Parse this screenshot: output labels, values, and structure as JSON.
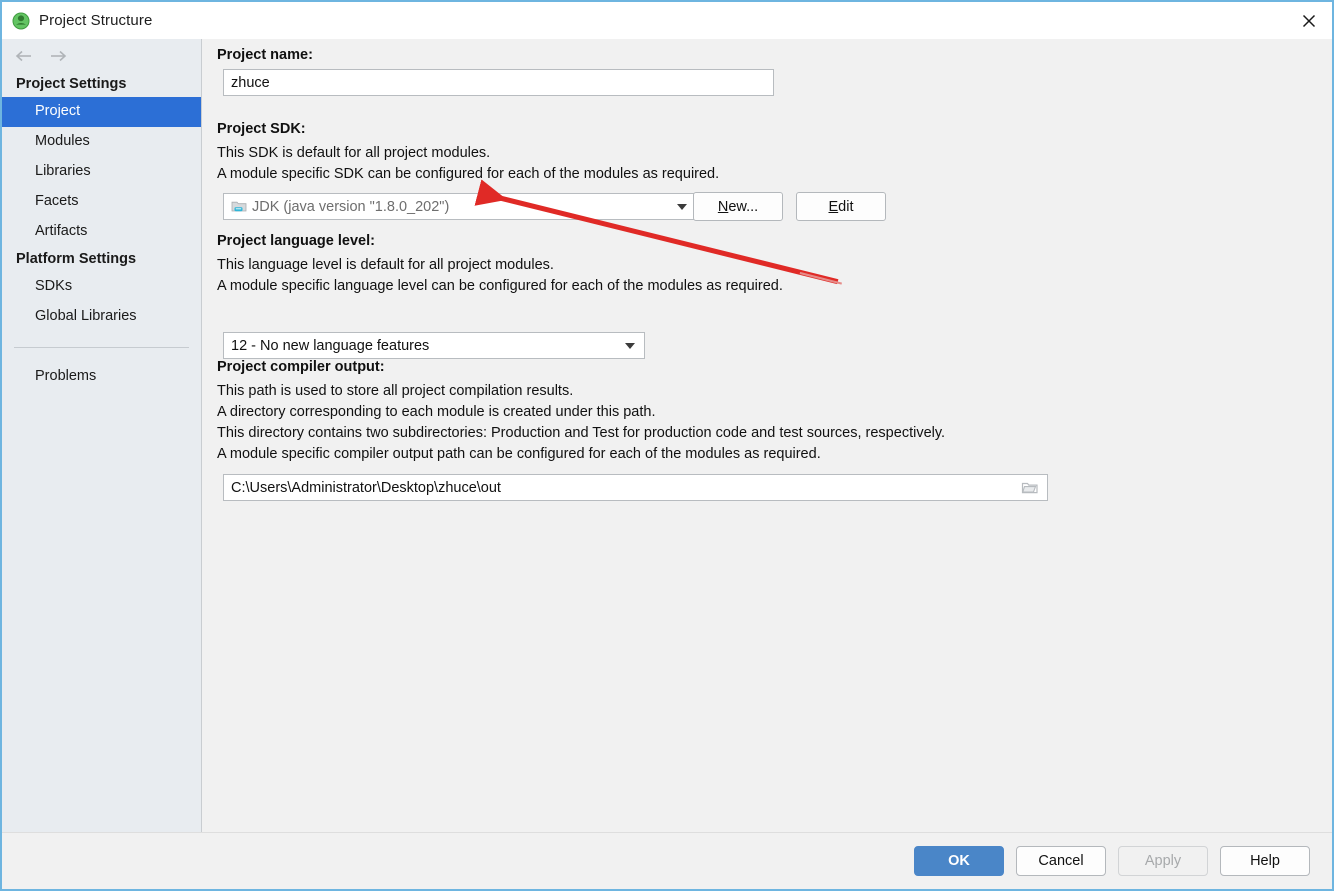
{
  "window": {
    "title": "Project Structure",
    "app_icon": "intellij-idea-icon",
    "close_icon": "close-icon",
    "border_color": "#6eb5e0"
  },
  "sidebar": {
    "back_icon": "arrow-left-icon",
    "forward_icon": "arrow-right-icon",
    "groups": [
      {
        "header": "Project Settings",
        "items": [
          {
            "label": "Project",
            "selected": true
          },
          {
            "label": "Modules",
            "selected": false
          },
          {
            "label": "Libraries",
            "selected": false
          },
          {
            "label": "Facets",
            "selected": false
          },
          {
            "label": "Artifacts",
            "selected": false
          }
        ]
      },
      {
        "header": "Platform Settings",
        "items": [
          {
            "label": "SDKs",
            "selected": false
          },
          {
            "label": "Global Libraries",
            "selected": false
          }
        ]
      }
    ],
    "problems_label": "Problems",
    "selection_color": "#2c6fd6",
    "background_color": "#e8ecf0"
  },
  "main": {
    "project_name": {
      "label": "Project name:",
      "value": "zhuce"
    },
    "project_sdk": {
      "label": "Project SDK:",
      "description": [
        "This SDK is default for all project modules.",
        "A module specific SDK can be configured for each of the modules as required."
      ],
      "selected": "JDK (java version \"1.8.0_202\")",
      "sdk_icon": "jdk-folder-icon",
      "dropdown_icon": "chevron-down-icon",
      "new_button": {
        "label": "New...",
        "mnemonic": "N"
      },
      "edit_button": {
        "label": "Edit",
        "mnemonic": "E"
      }
    },
    "language_level": {
      "label": "Project language level:",
      "description": [
        "This language level is default for all project modules.",
        "A module specific language level can be configured for each of the modules as required."
      ],
      "selected": "12 - No new language features",
      "dropdown_icon": "chevron-down-icon"
    },
    "compiler_output": {
      "label": "Project compiler output:",
      "description": [
        "This path is used to store all project compilation results.",
        "A directory corresponding to each module is created under this path.",
        "This directory contains two subdirectories: Production and Test for production code and test sources, respectively.",
        "A module specific compiler output path can be configured for each of the modules as required."
      ],
      "value": "C:\\Users\\Administrator\\Desktop\\zhuce\\out",
      "browse_icon": "folder-browse-icon"
    }
  },
  "annotation": {
    "type": "red-arrow",
    "color": "#e02a26",
    "points_to": "project-sdk-combo"
  },
  "footer": {
    "buttons": [
      {
        "label": "OK",
        "style": "default",
        "enabled": true
      },
      {
        "label": "Cancel",
        "style": "normal",
        "enabled": true
      },
      {
        "label": "Apply",
        "style": "disabled",
        "enabled": false
      },
      {
        "label": "Help",
        "style": "normal",
        "enabled": true
      }
    ]
  }
}
